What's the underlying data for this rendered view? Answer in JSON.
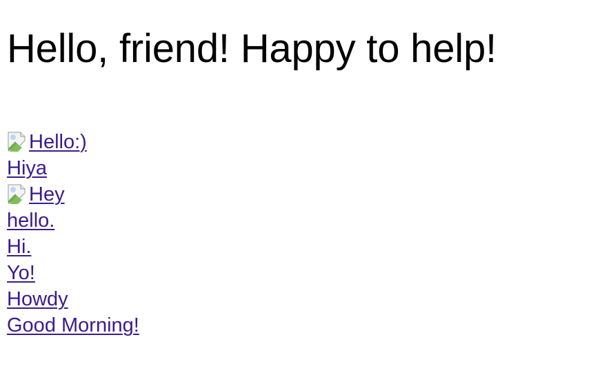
{
  "heading": "Hello, friend! Happy to help!",
  "links": [
    {
      "label": "Hello:)",
      "has_image": true,
      "icon": "broken-image-icon"
    },
    {
      "label": "Hiya",
      "has_image": false
    },
    {
      "label": "Hey",
      "has_image": true,
      "icon": "broken-image-icon"
    },
    {
      "label": "hello.",
      "has_image": false
    },
    {
      "label": "Hi.",
      "has_image": false
    },
    {
      "label": "Yo!",
      "has_image": false
    },
    {
      "label": "Howdy",
      "has_image": false
    },
    {
      "label": "Good Morning!",
      "has_image": false
    }
  ],
  "colors": {
    "link": "#3a1b8e",
    "text": "#000000",
    "background": "#ffffff"
  }
}
